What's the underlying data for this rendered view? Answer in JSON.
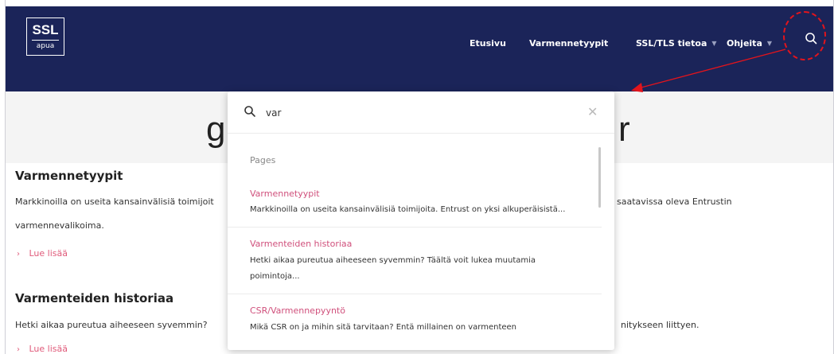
{
  "header": {
    "logo_top": "SSL",
    "logo_bottom": "apua",
    "nav": [
      {
        "label": "Etusivu"
      },
      {
        "label": "Varmennetyypit"
      },
      {
        "label": "SSL/TLS tietoa"
      },
      {
        "label": "Ohjeita"
      }
    ]
  },
  "hero": {
    "left_fragment": "g",
    "right_fragment": "r"
  },
  "sections": [
    {
      "title": "Varmennetyypit",
      "text_line1_left": "Markkinoilla on useita kansainvälisiä toimijoit",
      "text_line1_right": "saatavissa oleva Entrustin",
      "text_line2": "varmennevalikoima.",
      "read_more": "Lue lisää"
    },
    {
      "title": "Varmenteiden historiaa",
      "text_line1_left": "Hetki aikaa pureutua aiheeseen syvemmin?",
      "text_line1_right": "nitykseen liittyen.",
      "read_more": "Lue lisää"
    }
  ],
  "search": {
    "query": "var",
    "group_label": "Pages",
    "results": [
      {
        "title": "Varmennetyypit",
        "desc": "Markkinoilla on useita kansainvälisiä toimijoita. Entrust on yksi alkuperäisistä..."
      },
      {
        "title": "Varmenteiden historiaa",
        "desc_line1": "Hetki aikaa pureutua aiheeseen syvemmin? Täältä voit lukea muutamia",
        "desc_line2": "poimintoja..."
      },
      {
        "title": "CSR/Varmennepyyntö",
        "desc": "Mikä CSR on ja mihin sitä tarvitaan? Entä millainen on varmenteen"
      }
    ]
  },
  "colors": {
    "header_bg": "#1b2459",
    "accent_pink": "#d0507c",
    "annotation_red": "#e3141c"
  }
}
